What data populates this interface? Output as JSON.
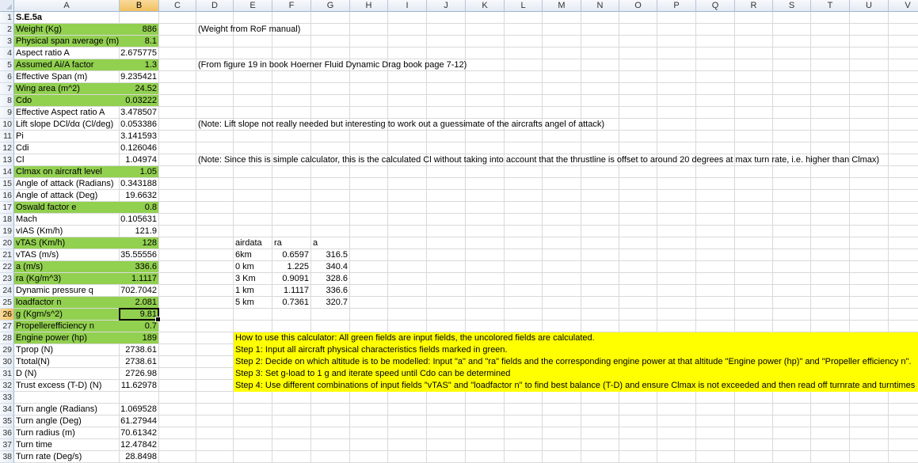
{
  "columns": [
    "A",
    "B",
    "C",
    "D",
    "E",
    "F",
    "G",
    "H",
    "I",
    "J",
    "K",
    "L",
    "M",
    "N",
    "O",
    "P",
    "Q",
    "R",
    "S",
    "T",
    "U",
    "V"
  ],
  "selected_column": "B",
  "selected_row": 26,
  "rows": [
    {
      "r": 1,
      "a": "S.E.5a",
      "bold": true
    },
    {
      "r": 2,
      "a": "Weight (Kg)",
      "b": "886",
      "green": true,
      "d": "(Weight from RoF manual)"
    },
    {
      "r": 3,
      "a": "Physical span average (m)",
      "b": "8.1",
      "green": true
    },
    {
      "r": 4,
      "a": "Aspect ratio A",
      "b": "2.675775"
    },
    {
      "r": 5,
      "a": "Assumed Ai/A factor",
      "b": "1.3",
      "green": true,
      "d": "(From figure 19 in book Hoerner Fluid Dynamic Drag book page 7-12)"
    },
    {
      "r": 6,
      "a": "Effective Span (m)",
      "b": "9.235421"
    },
    {
      "r": 7,
      "a": "Wing area (m^2)",
      "b": "24.52",
      "green": true
    },
    {
      "r": 8,
      "a": "Cdo",
      "b": "0.03222",
      "green": true
    },
    {
      "r": 9,
      "a": "Effective Aspect ratio A",
      "b": "3.478507"
    },
    {
      "r": 10,
      "a": "Lift slope DCl/dα (Cl/deg)",
      "b": "0.053386",
      "d": "(Note: Lift slope not really needed but interesting to work out a guessimate of the aircrafts angel of attack)"
    },
    {
      "r": 11,
      "a": "Pi",
      "b": "3.141593"
    },
    {
      "r": 12,
      "a": "Cdi",
      "b": "0.126046"
    },
    {
      "r": 13,
      "a": "Cl",
      "b": "1.04974",
      "d": "(Note: Since this is simple calculator, this is the calculated Cl without taking into account that the thrustline is offset to around 20 degrees at max turn rate, i.e. higher than Clmax)"
    },
    {
      "r": 14,
      "a": "Clmax on aircraft level",
      "b": "1.05",
      "green": true
    },
    {
      "r": 15,
      "a": "Angle of attack (Radians)",
      "b": "0.343188"
    },
    {
      "r": 16,
      "a": "Angle of attack (Deg)",
      "b": "19.6632"
    },
    {
      "r": 17,
      "a": "Oswald factor e",
      "b": "0.8",
      "green": true
    },
    {
      "r": 18,
      "a": "Mach",
      "b": "0.105631"
    },
    {
      "r": 19,
      "a": "vIAS (Km/h)",
      "b": "121.9"
    },
    {
      "r": 20,
      "a": "vTAS (Km/h)",
      "b": "128",
      "green": true,
      "e": "airdata",
      "f": "ra",
      "g": "a",
      "f_left": true,
      "g_left": true
    },
    {
      "r": 21,
      "a": "vTAS (m/s)",
      "b": "35.55556",
      "e": "6km",
      "f": "0.6597",
      "g": "316.5"
    },
    {
      "r": 22,
      "a": "a (m/s)",
      "b": "336.6",
      "green": true,
      "e": "0 km",
      "f": "1.225",
      "g": "340.4"
    },
    {
      "r": 23,
      "a": "ra (Kg/m^3)",
      "b": "1.1117",
      "green": true,
      "e": "3 Km",
      "f": "0.9091",
      "g": "328.6"
    },
    {
      "r": 24,
      "a": "Dynamic pressure q",
      "b": "702.7042",
      "e": "1 km",
      "f": "1.1117",
      "g": "336.6"
    },
    {
      "r": 25,
      "a": "loadfactor n",
      "b": "2.081",
      "green": true,
      "e": "5 km",
      "f": "0.7361",
      "g": "320.7"
    },
    {
      "r": 26,
      "a": "g (Kgm/s^2)",
      "b": "9.81",
      "green": true
    },
    {
      "r": 27,
      "a": "Propellerefficiency n",
      "b": "0.7",
      "green": true
    },
    {
      "r": 28,
      "a": "Engine power (hp)",
      "b": "189",
      "green": true,
      "y": "How to use this calculator: All green fields are input fields, the uncolored fields are calculated."
    },
    {
      "r": 29,
      "a": "Tprop (N)",
      "b": "2738.61",
      "y": "Step 1: Input all aircraft physical characteristics fields marked in green."
    },
    {
      "r": 30,
      "a": "Ttotal(N)",
      "b": "2738.61",
      "y": "Step 2: Decide on which altitude is to be modelled: Input \"a\" and \"ra\" fields and the corresponding engine power at that altitude \"Engine power (hp)\" and \"Propeller efficiency n\"."
    },
    {
      "r": 31,
      "a": "D (N)",
      "b": "2726.98",
      "y": "Step 3: Set g-load to 1 g and iterate speed until Cdo can be determined"
    },
    {
      "r": 32,
      "a": "Trust excess (T-D) (N)",
      "b": "11.62978",
      "y": "Step 4: Use different combinations of input fields \"vTAS\" and \"loadfactor n\" to find best balance (T-D) and ensure Clmax is not exceeded and then read off turnrate and turntimes"
    },
    {
      "r": 33
    },
    {
      "r": 34,
      "a": "Turn angle (Radians)",
      "b": "1.069528"
    },
    {
      "r": 35,
      "a": "Turn angle (Deg)",
      "b": "61.27944"
    },
    {
      "r": 36,
      "a": "Turn radius (m)",
      "b": "70.61342"
    },
    {
      "r": 37,
      "a": "Turn time",
      "b": "12.47842"
    },
    {
      "r": 38,
      "a": "Turn rate (Deg/s)",
      "b": "28.8498"
    }
  ]
}
